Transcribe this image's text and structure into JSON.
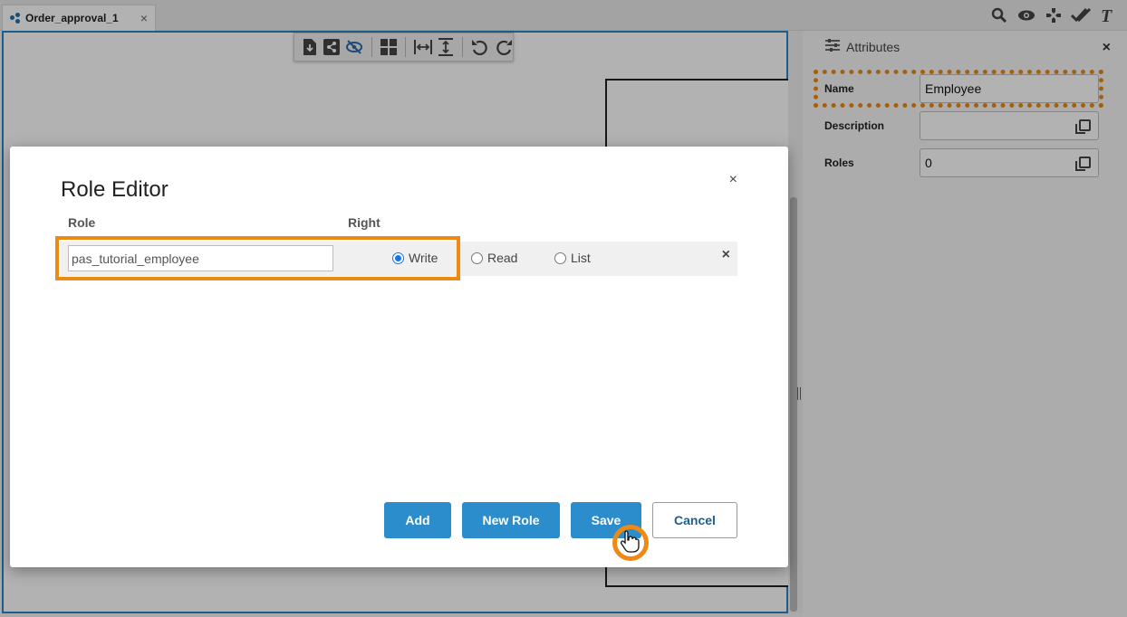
{
  "tab": {
    "title": "Order_approval_1",
    "close": "×"
  },
  "top_tools": [
    "search-icon",
    "eye-icon",
    "game-icon",
    "double-check-icon",
    "text-icon"
  ],
  "canvas_toolbar": [
    "export-icon",
    "share-icon",
    "hide-icon",
    "grid-icon",
    "fit-width-icon",
    "fit-height-icon",
    "undo-icon",
    "redo-icon"
  ],
  "attributes": {
    "title": "Attributes",
    "close": "×",
    "fields": [
      {
        "label": "Name",
        "value": "Employee"
      },
      {
        "label": "Description",
        "value": ""
      },
      {
        "label": "Roles",
        "value": "0"
      }
    ]
  },
  "modal": {
    "title": "Role Editor",
    "close": "×",
    "columns": {
      "role": "Role",
      "right": "Right"
    },
    "row": {
      "role_value": "pas_tutorial_employee",
      "options": [
        "Write",
        "Read",
        "List"
      ],
      "selected": "Write",
      "delete": "×"
    },
    "buttons": {
      "add": "Add",
      "new_role": "New Role",
      "save": "Save",
      "cancel": "Cancel"
    }
  },
  "colors": {
    "accent": "#2c8dcd",
    "highlight": "#ee8a13",
    "radio_selected": "#1a73e8"
  }
}
